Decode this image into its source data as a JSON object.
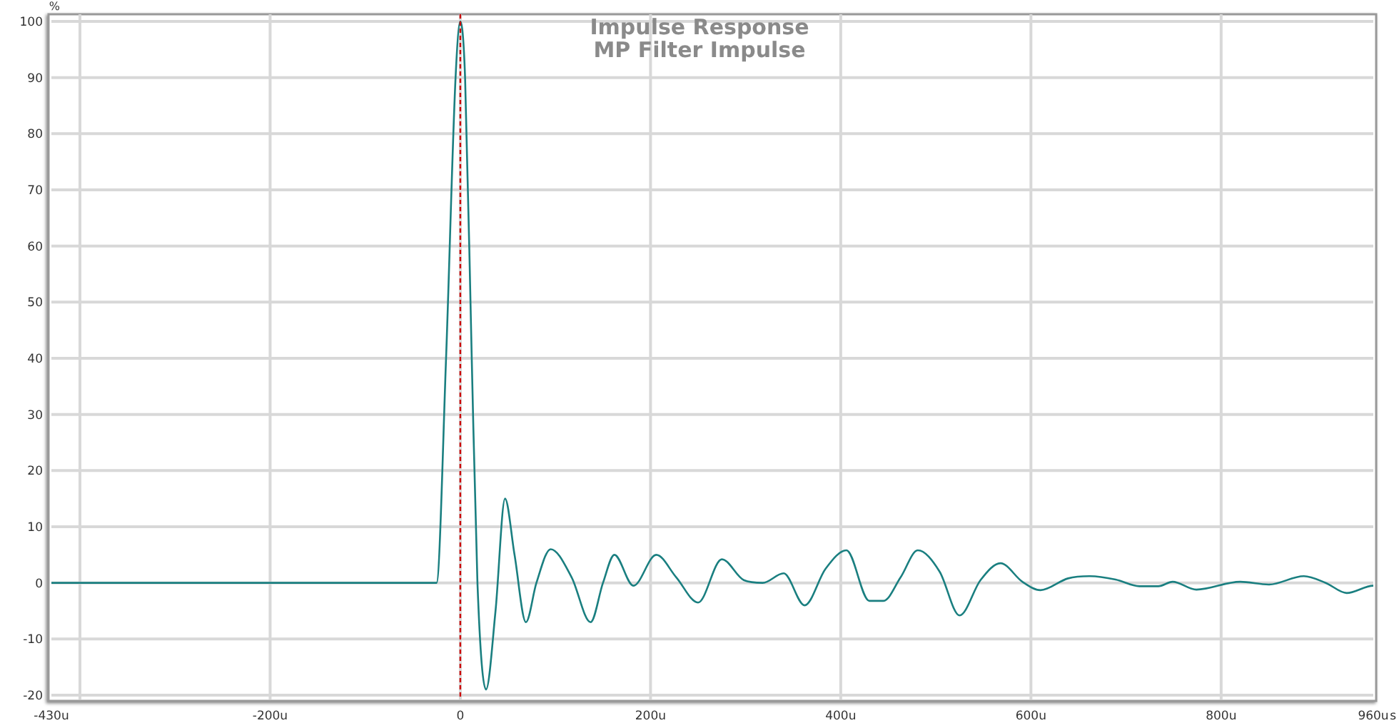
{
  "chart": {
    "chart_data": {
      "type": "line",
      "title": "Impulse Response",
      "xlabel": "s",
      "ylabel": "%",
      "grid": true,
      "x": [
        -430,
        -25,
        -15,
        -5,
        0,
        5,
        12,
        18,
        27,
        37,
        47,
        57,
        69,
        80,
        95,
        117,
        137,
        150,
        162,
        182,
        206,
        227,
        250,
        275,
        298,
        318,
        340,
        362,
        384,
        406,
        430,
        445,
        463,
        481,
        504,
        525,
        547,
        568,
        591,
        610,
        639,
        662,
        689,
        714,
        734,
        749,
        774,
        820,
        850,
        887,
        910,
        932,
        960
      ],
      "series": [
        {
          "name": "MP Filter Impulse",
          "color": "#1a7f80",
          "values": [
            0,
            0,
            40,
            90,
            100,
            90,
            40,
            0,
            -19,
            -5,
            15,
            5,
            -7,
            0,
            6,
            1,
            -7,
            0,
            5,
            -0.5,
            5,
            1,
            -3.5,
            4.2,
            0.5,
            0,
            1.7,
            -4,
            2.5,
            5.8,
            -3.2,
            -3.2,
            1,
            5.8,
            2,
            -5.8,
            0.5,
            3.5,
            0.2,
            -1.3,
            0.8,
            1.2,
            0.6,
            -0.6,
            -0.6,
            0.2,
            -1.2,
            0.2,
            -0.3,
            1.2,
            0,
            -1.8,
            -0.5
          ]
        }
      ],
      "xlim": [
        -430,
        960
      ],
      "ylim": [
        -20,
        100
      ],
      "xticks": [
        {
          "value": -430,
          "label": "-430u"
        },
        {
          "value": -200,
          "label": "-200u"
        },
        {
          "value": 0,
          "label": "0"
        },
        {
          "value": 200,
          "label": "200u"
        },
        {
          "value": 400,
          "label": "400u"
        },
        {
          "value": 600,
          "label": "600u"
        },
        {
          "value": 800,
          "label": "800u"
        },
        {
          "value": 960,
          "label": "960u"
        }
      ],
      "yticks": [
        -20,
        -10,
        0,
        10,
        20,
        30,
        40,
        50,
        60,
        70,
        80,
        90,
        100
      ],
      "ref_lines": [
        {
          "axis": "x",
          "value": 0,
          "color": "#cc0000"
        }
      ]
    }
  }
}
